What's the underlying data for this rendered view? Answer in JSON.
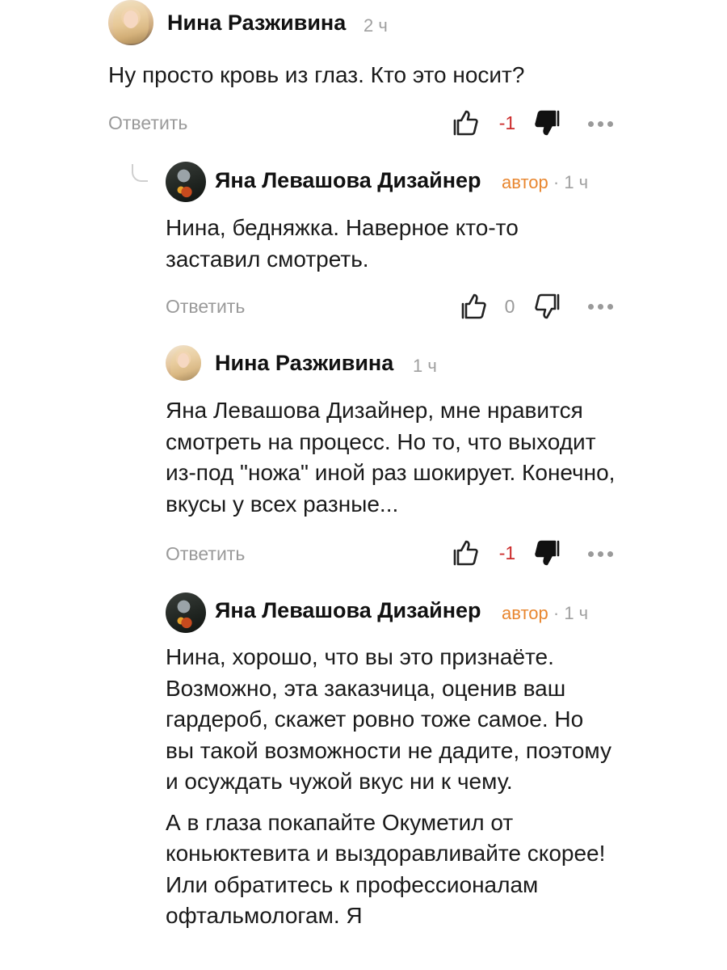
{
  "comments": [
    {
      "author": "Нина Разживина",
      "time": "2 ч",
      "paragraphs": [
        "Ну просто кровь из глаз. Кто это носит?"
      ],
      "reply_label": "Ответить",
      "rating": "-1",
      "like_icon": "thumbs-up-outline-icon",
      "dislike_icon": "thumbs-down-filled-icon"
    },
    {
      "author": "Яна Левашова Дизайнер",
      "author_tag": "автор",
      "separator": "·",
      "time": "1 ч",
      "paragraphs": [
        "Нина, бедняжка. Наверное кто-то заставил смотреть."
      ],
      "reply_label": "Ответить",
      "rating": "0",
      "like_icon": "thumbs-up-outline-icon",
      "dislike_icon": "thumbs-down-outline-icon"
    },
    {
      "author": "Нина Разживина",
      "time": "1 ч",
      "paragraphs": [
        "Яна Левашова Дизайнер, мне нравится смотреть на процесс. Но то, что выходит из-под \"ножа\" иной раз шокирует. Конечно, вкусы у всех разные..."
      ],
      "reply_label": "Ответить",
      "rating": "-1",
      "like_icon": "thumbs-up-outline-icon",
      "dislike_icon": "thumbs-down-filled-icon"
    },
    {
      "author": "Яна Левашова Дизайнер",
      "author_tag": "автор",
      "separator": "·",
      "time": "1 ч",
      "paragraphs": [
        "Нина, хорошо, что вы это признаёте. Возможно, эта заказчица, оценив ваш гардероб, скажет ровно тоже самое. Но вы такой возможности не дадите, поэтому и осуждать чужой вкус ни к чему.",
        "А в глаза покапайте Окуметил от коньюктевита и выздоравливайте скорее! Или обратитесь к профессионалам офтальмологам. Я"
      ]
    }
  ],
  "colors": {
    "author_tag": "#e8862f",
    "negative_rating": "#cc2b2b",
    "muted": "#9a9a9a"
  }
}
